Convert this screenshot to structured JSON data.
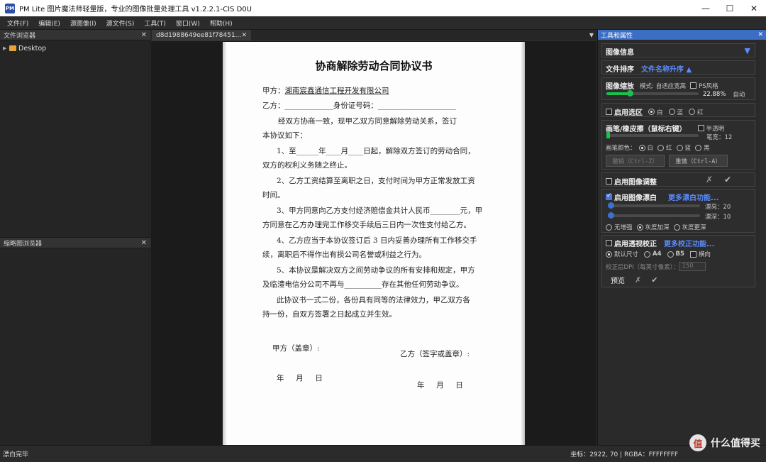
{
  "window": {
    "app_icon_text": "PM",
    "title": "PM Lite 图片魔法师轻量版，专业的图像批量处理工具 v1.2.2.1-CIS D0U"
  },
  "menu": [
    "文件(F)",
    "编辑(E)",
    "源图像(I)",
    "源文件(S)",
    "工具(T)",
    "窗口(W)",
    "帮助(H)"
  ],
  "left": {
    "file_browser_title": "文件浏览器",
    "tree_root": "Desktop",
    "thumb_browser_title": "缩略图浏览器"
  },
  "center": {
    "tab_label": "d8d1988649ee81f78451..."
  },
  "document": {
    "title": "协商解除劳动合同协议书",
    "party_a_label": "甲方：",
    "party_a_company": "湖南宸鑫通信工程开发有限公司",
    "party_b_line": "乙方：_____________身份证号码：_____________________",
    "lines": [
      "经双方协商一致，现甲乙双方同意解除劳动关系，签订",
      "本协议如下：",
      "1、至______年____月____日起，解除双方签订的劳动合同，",
      "双方的权利义务随之终止。",
      "2、乙方工资结算至离职之日，支付时间为甲方正常发放工资",
      "时间。",
      "3、甲方同意向乙方支付经济赔偿金共计人民币________元，甲",
      "方同意在乙方办理完工作移交手续后三日内一次性支付给乙方。",
      "4、乙方应当于本协议签订后 3 日内妥善办理所有工作移交手",
      "续，离职后不得作出有损公司名誉或利益之行为。",
      "5、本协议是解决双方之间劳动争议的所有安排和规定，甲方",
      "及临澧电信分公司不再与__________存在其他任何劳动争议。",
      "此协议书一式二份，各份具有同等的法律效力，甲乙双方各",
      "持一份，自双方签署之日起成立并生效。"
    ],
    "sign_a": "甲方（盖章）:",
    "sign_b": "乙方（签字或盖章）:",
    "date_a": "年     月     日",
    "date_b": "年     月     日"
  },
  "right": {
    "header": "工具和属性",
    "image_info": "图像信息",
    "file_sort_label": "文件排序",
    "file_sort_value": "文件名称升序 ▲",
    "zoom": {
      "label": "图像缩放",
      "mode_label": "模式: 自适应宽高",
      "ps_style": "PS风格",
      "percent": "22.88%",
      "auto": "自动",
      "level": 0.25
    },
    "selection": {
      "label": "启用选区",
      "options": [
        "白",
        "蓝",
        "红"
      ]
    },
    "brush": {
      "label": "画笔/橡皮擦（鼠标右键）",
      "translucent": "半透明",
      "width_text": "笔宽：12",
      "color_label": "画笔颜色：",
      "colors": [
        "白",
        "红",
        "蓝",
        "黑"
      ],
      "undo": "撤销（Ctrl-Z）",
      "redo": "重做（Ctrl-A）",
      "level": 0.02
    },
    "adjust": {
      "label": "启用图像调整"
    },
    "whiten": {
      "label": "启用图像漂白",
      "more": "更多漂白功能...",
      "bleach_text": "漂亮：20",
      "depth_text": "漂深：10",
      "options": [
        "无增强",
        "灰度加深",
        "灰度更深"
      ],
      "bleach_level": 0.02,
      "depth_level": 0.02
    },
    "perspective": {
      "label": "启用透视校正",
      "more": "更多校正功能...",
      "sizes": [
        "默认尺寸",
        "A4",
        "B5"
      ],
      "landscape": "横向",
      "dpi_label": "校正后DPI（每英寸像素）：",
      "dpi_value": "150",
      "preview": "预览"
    }
  },
  "status": {
    "left": "漂白完毕",
    "right": "坐标：2922, 70  |  RGBA：FFFFFFFF"
  },
  "watermark": {
    "badge": "值",
    "text": "什么值得买"
  },
  "colors": {
    "accent": "#3c6ec4",
    "link_blue": "#5a8cff",
    "slider_green": "#19c24a",
    "slider_blue": "#3b6fd0"
  }
}
